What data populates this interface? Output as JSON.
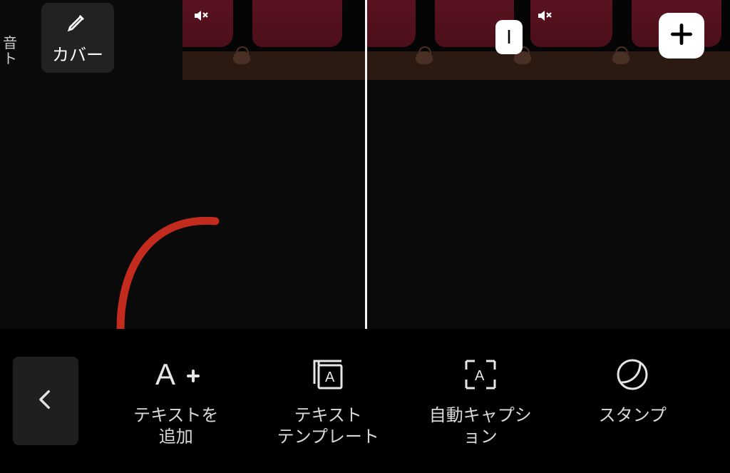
{
  "side_label": "音\nト",
  "cover": {
    "label": "カバー"
  },
  "split_handle_glyph": "I",
  "toolbar": {
    "add_text": {
      "label": "テキストを\n追加"
    },
    "template": {
      "label": "テキスト\nテンプレート"
    },
    "auto_cap": {
      "label": "自動キャプシ\nョン"
    },
    "sticker": {
      "label": "スタンプ"
    }
  }
}
